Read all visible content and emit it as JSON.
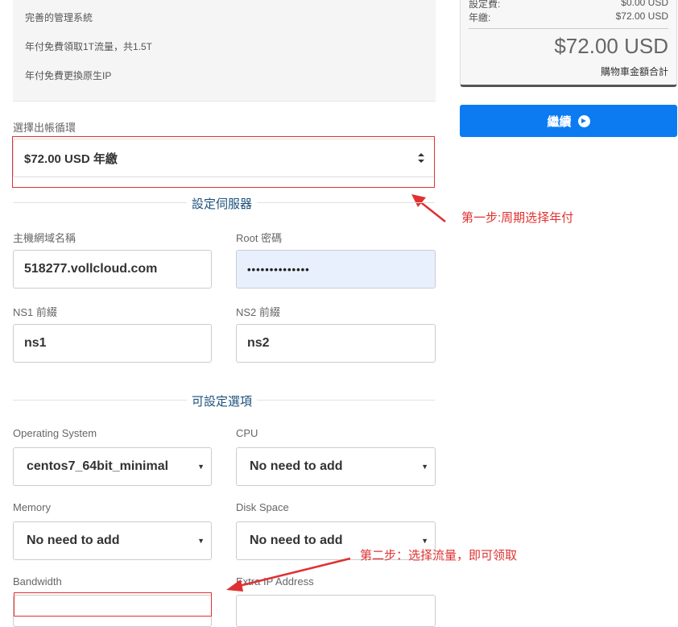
{
  "features": {
    "lines": [
      "完善的管理系統",
      "年付免費領取1T流量，共1.5T",
      "年付免費更換原生IP"
    ]
  },
  "billing": {
    "label": "選擇出帳循環",
    "selected": "$72.00 USD 年繳"
  },
  "server_section": {
    "title": "設定伺服器",
    "hostname_label": "主機網域名稱",
    "hostname_value": "518277.vollcloud.com",
    "root_password_label": "Root 密碼",
    "root_password_value": "••••••••••••••",
    "ns1_label": "NS1 前綴",
    "ns1_value": "ns1",
    "ns2_label": "NS2 前綴",
    "ns2_value": "ns2"
  },
  "options_section": {
    "title": "可設定選項",
    "os_label": "Operating System",
    "os_value": "centos7_64bit_minimal",
    "cpu_label": "CPU",
    "cpu_value": "No need to add",
    "memory_label": "Memory",
    "memory_value": "No need to add",
    "disk_label": "Disk Space",
    "disk_value": "No need to add",
    "bandwidth_label": "Bandwidth",
    "extra_ip_label": "Extra IP Address"
  },
  "summary": {
    "setup_fee_label": "設定費:",
    "setup_fee_value": "$0.00 USD",
    "annual_label": "年繳:",
    "annual_value": "$72.00 USD",
    "total": "$72.00 USD",
    "total_label": "購物車金額合計",
    "continue_label": "繼續"
  },
  "annotations": {
    "step1": "第一步:周期选择年付",
    "step2": "第二步：选择流量，即可领取",
    "color": "#e03131"
  },
  "colors": {
    "accent": "#0c7bf2",
    "section_title": "#1a4f7a",
    "autofill_bg": "#e8f0fe"
  }
}
